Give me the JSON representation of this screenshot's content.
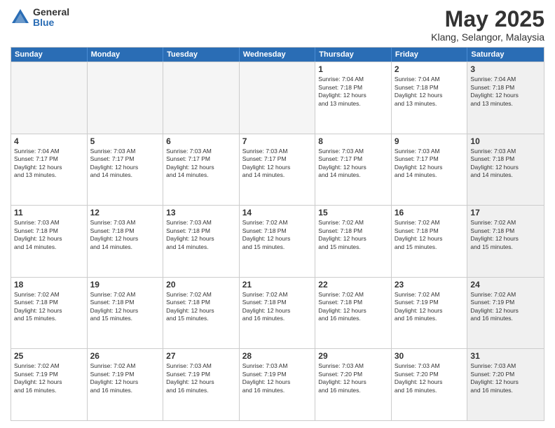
{
  "logo": {
    "general": "General",
    "blue": "Blue"
  },
  "title": "May 2025",
  "location": "Klang, Selangor, Malaysia",
  "days_of_week": [
    "Sunday",
    "Monday",
    "Tuesday",
    "Wednesday",
    "Thursday",
    "Friday",
    "Saturday"
  ],
  "weeks": [
    [
      {
        "day": "",
        "info": "",
        "empty": true
      },
      {
        "day": "",
        "info": "",
        "empty": true
      },
      {
        "day": "",
        "info": "",
        "empty": true
      },
      {
        "day": "",
        "info": "",
        "empty": true
      },
      {
        "day": "1",
        "info": "Sunrise: 7:04 AM\nSunset: 7:18 PM\nDaylight: 12 hours\nand 13 minutes."
      },
      {
        "day": "2",
        "info": "Sunrise: 7:04 AM\nSunset: 7:18 PM\nDaylight: 12 hours\nand 13 minutes."
      },
      {
        "day": "3",
        "info": "Sunrise: 7:04 AM\nSunset: 7:18 PM\nDaylight: 12 hours\nand 13 minutes.",
        "shaded": true
      }
    ],
    [
      {
        "day": "4",
        "info": "Sunrise: 7:04 AM\nSunset: 7:17 PM\nDaylight: 12 hours\nand 13 minutes."
      },
      {
        "day": "5",
        "info": "Sunrise: 7:03 AM\nSunset: 7:17 PM\nDaylight: 12 hours\nand 14 minutes."
      },
      {
        "day": "6",
        "info": "Sunrise: 7:03 AM\nSunset: 7:17 PM\nDaylight: 12 hours\nand 14 minutes."
      },
      {
        "day": "7",
        "info": "Sunrise: 7:03 AM\nSunset: 7:17 PM\nDaylight: 12 hours\nand 14 minutes."
      },
      {
        "day": "8",
        "info": "Sunrise: 7:03 AM\nSunset: 7:17 PM\nDaylight: 12 hours\nand 14 minutes."
      },
      {
        "day": "9",
        "info": "Sunrise: 7:03 AM\nSunset: 7:17 PM\nDaylight: 12 hours\nand 14 minutes."
      },
      {
        "day": "10",
        "info": "Sunrise: 7:03 AM\nSunset: 7:18 PM\nDaylight: 12 hours\nand 14 minutes.",
        "shaded": true
      }
    ],
    [
      {
        "day": "11",
        "info": "Sunrise: 7:03 AM\nSunset: 7:18 PM\nDaylight: 12 hours\nand 14 minutes."
      },
      {
        "day": "12",
        "info": "Sunrise: 7:03 AM\nSunset: 7:18 PM\nDaylight: 12 hours\nand 14 minutes."
      },
      {
        "day": "13",
        "info": "Sunrise: 7:03 AM\nSunset: 7:18 PM\nDaylight: 12 hours\nand 14 minutes."
      },
      {
        "day": "14",
        "info": "Sunrise: 7:02 AM\nSunset: 7:18 PM\nDaylight: 12 hours\nand 15 minutes."
      },
      {
        "day": "15",
        "info": "Sunrise: 7:02 AM\nSunset: 7:18 PM\nDaylight: 12 hours\nand 15 minutes."
      },
      {
        "day": "16",
        "info": "Sunrise: 7:02 AM\nSunset: 7:18 PM\nDaylight: 12 hours\nand 15 minutes."
      },
      {
        "day": "17",
        "info": "Sunrise: 7:02 AM\nSunset: 7:18 PM\nDaylight: 12 hours\nand 15 minutes.",
        "shaded": true
      }
    ],
    [
      {
        "day": "18",
        "info": "Sunrise: 7:02 AM\nSunset: 7:18 PM\nDaylight: 12 hours\nand 15 minutes."
      },
      {
        "day": "19",
        "info": "Sunrise: 7:02 AM\nSunset: 7:18 PM\nDaylight: 12 hours\nand 15 minutes."
      },
      {
        "day": "20",
        "info": "Sunrise: 7:02 AM\nSunset: 7:18 PM\nDaylight: 12 hours\nand 15 minutes."
      },
      {
        "day": "21",
        "info": "Sunrise: 7:02 AM\nSunset: 7:18 PM\nDaylight: 12 hours\nand 16 minutes."
      },
      {
        "day": "22",
        "info": "Sunrise: 7:02 AM\nSunset: 7:18 PM\nDaylight: 12 hours\nand 16 minutes."
      },
      {
        "day": "23",
        "info": "Sunrise: 7:02 AM\nSunset: 7:19 PM\nDaylight: 12 hours\nand 16 minutes."
      },
      {
        "day": "24",
        "info": "Sunrise: 7:02 AM\nSunset: 7:19 PM\nDaylight: 12 hours\nand 16 minutes.",
        "shaded": true
      }
    ],
    [
      {
        "day": "25",
        "info": "Sunrise: 7:02 AM\nSunset: 7:19 PM\nDaylight: 12 hours\nand 16 minutes."
      },
      {
        "day": "26",
        "info": "Sunrise: 7:02 AM\nSunset: 7:19 PM\nDaylight: 12 hours\nand 16 minutes."
      },
      {
        "day": "27",
        "info": "Sunrise: 7:03 AM\nSunset: 7:19 PM\nDaylight: 12 hours\nand 16 minutes."
      },
      {
        "day": "28",
        "info": "Sunrise: 7:03 AM\nSunset: 7:19 PM\nDaylight: 12 hours\nand 16 minutes."
      },
      {
        "day": "29",
        "info": "Sunrise: 7:03 AM\nSunset: 7:20 PM\nDaylight: 12 hours\nand 16 minutes."
      },
      {
        "day": "30",
        "info": "Sunrise: 7:03 AM\nSunset: 7:20 PM\nDaylight: 12 hours\nand 16 minutes."
      },
      {
        "day": "31",
        "info": "Sunrise: 7:03 AM\nSunset: 7:20 PM\nDaylight: 12 hours\nand 16 minutes.",
        "shaded": true
      }
    ]
  ]
}
